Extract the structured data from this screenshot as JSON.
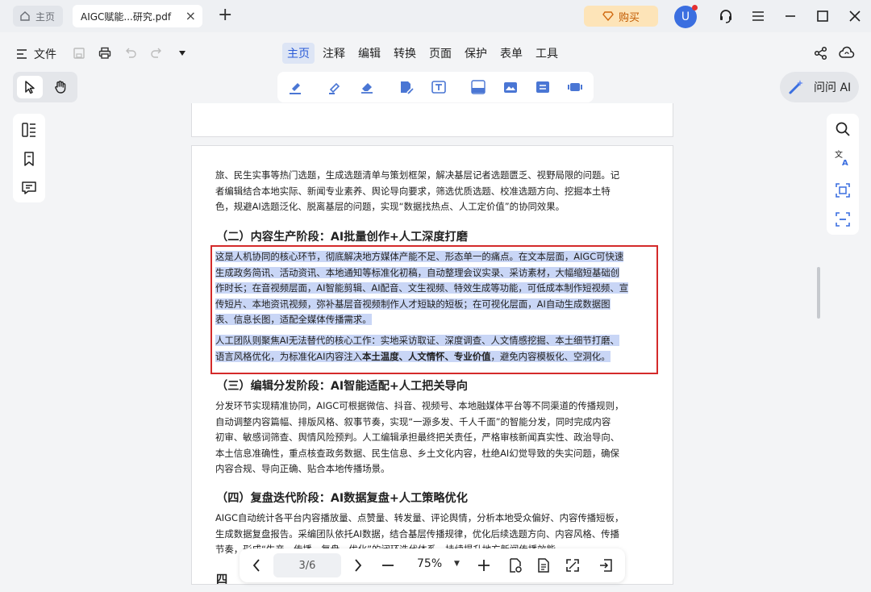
{
  "titlebar": {
    "home_tab": "主页",
    "doc_tab": "AIGC赋能...研究.pdf",
    "buy_label": "购买",
    "avatar_letter": "U"
  },
  "menubar": {
    "file_label": "文件",
    "menus": [
      "主页",
      "注释",
      "编辑",
      "转换",
      "页面",
      "保护",
      "表单",
      "工具"
    ],
    "active_menu": "主页"
  },
  "ask_ai_label": "问问 AI",
  "document": {
    "intro_lines": [
      "旅、民生实事等热门选题，生成选题清单与策划框架，解决基层记者选题匮乏、视野局限的问题。记",
      "者编辑结合本地实际、新闻专业素养、舆论导向要求，筛选优质选题、校准选题方向、挖掘本土特",
      "色，规避AI选题泛化、脱离基层的问题，实现“数据找热点、人工定价值”的协同效果。"
    ],
    "heading2": "（二）内容生产阶段：AI批量创作+人工深度打磨",
    "para2a_lines": [
      "这是人机协同的核心环节，彻底解决地方媒体产能不足、形态单一的痛点。在文本层面，AIGC可快速",
      "生成政务简讯、活动资讯、本地通知等标准化初稿，自动整理会议实录、采访素材，大幅缩短基础创",
      "作时长；在音视频层面，AI智能剪辑、AI配音、文生视频、特效生成等功能，可低成本制作短视频、宣",
      "传短片、本地资讯视频，弥补基层音视频制作人才短缺的短板；在可视化层面，AI自动生成数据图",
      "表、信息长图，适配全媒体传播需求。"
    ],
    "para2b_line1": "人工团队则聚焦AI无法替代的核心工作：实地采访取证、深度调查、人文情感挖掘、本土细节打磨、",
    "para2b_line2_pre": "语言风格优化，为标准化AI内容注入",
    "para2b_line2_bold": "本土温度、人文情怀、专业价值",
    "para2b_line2_post": "，避免内容模板化、空洞化。",
    "heading3": "（三）编辑分发阶段：AI智能适配+人工把关导向",
    "para3_lines": [
      "分发环节实现精准协同，AIGC可根据微信、抖音、视频号、本地融媒体平台等不同渠道的传播规则，",
      "自动调整内容篇幅、排版风格、叙事节奏，实现“一源多发、千人千面”的智能分发，同时完成内容",
      "初审、敏感词筛查、舆情风险预判。人工编辑承担最终把关责任，严格审核新闻真实性、政治导向、",
      "本土信息准确性，重点核查政务数据、民生信息、乡土文化内容，杜绝AI幻觉导致的失实问题，确保",
      "内容合规、导向正确、贴合本地传播场景。"
    ],
    "heading4": "（四）复盘迭代阶段：AI数据复盘+人工策略优化",
    "para4_lines": [
      "AIGC自动统计各平台内容播放量、点赞量、转发量、评论舆情，分析本地受众偏好、内容传播短板，",
      "生成数据复盘报告。采编团队依托AI数据，结合基层传播规律，优化后续选题方向、内容风格、传播",
      "节奏，形成“生产—传播—复盘—优化”的闭环迭代体系，持续提升地方新闻传播效能。"
    ],
    "heading5_partial": "四"
  },
  "navigator": {
    "page_indicator": "3/6",
    "zoom_level": "75%"
  },
  "colors": {
    "accent": "#2a5bd7",
    "highlight": "#c9d6f6",
    "selection_border": "#d42a2a",
    "buy_bg": "#fde4b8"
  }
}
